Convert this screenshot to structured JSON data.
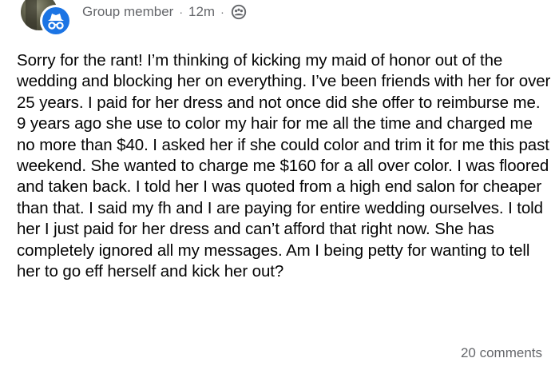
{
  "post": {
    "author_label": "Group member",
    "separator": "·",
    "time": "12m",
    "privacy_icon": "group-privacy-icon",
    "badge_icon": "anonymous-incognito-icon",
    "body": "Sorry for the rant! I’m thinking of kicking my maid of honor out of the wedding and blocking her on everything. I’ve been friends with her for over 25 years. I paid for her dress and not once did she offer to reimburse me. 9 years ago she use to color my hair for me all the time and charged me no more than $40. I asked her if she could color and trim it for me this past weekend. She wanted to charge me $160 for a all over color. I was floored and taken back. I told her I was quoted from a high end salon for cheaper than that. I said my fh and I are paying for entire wedding ourselves. I told her I just paid for her dress and can’t afford that right now. She has completely ignored all my messages. Am I being petty for wanting to tell her to go eff herself and kick her out?",
    "comments_count": "20 comments"
  },
  "colors": {
    "accent": "#1b74e4",
    "meta_text": "#65676b",
    "body_text": "#050505"
  }
}
